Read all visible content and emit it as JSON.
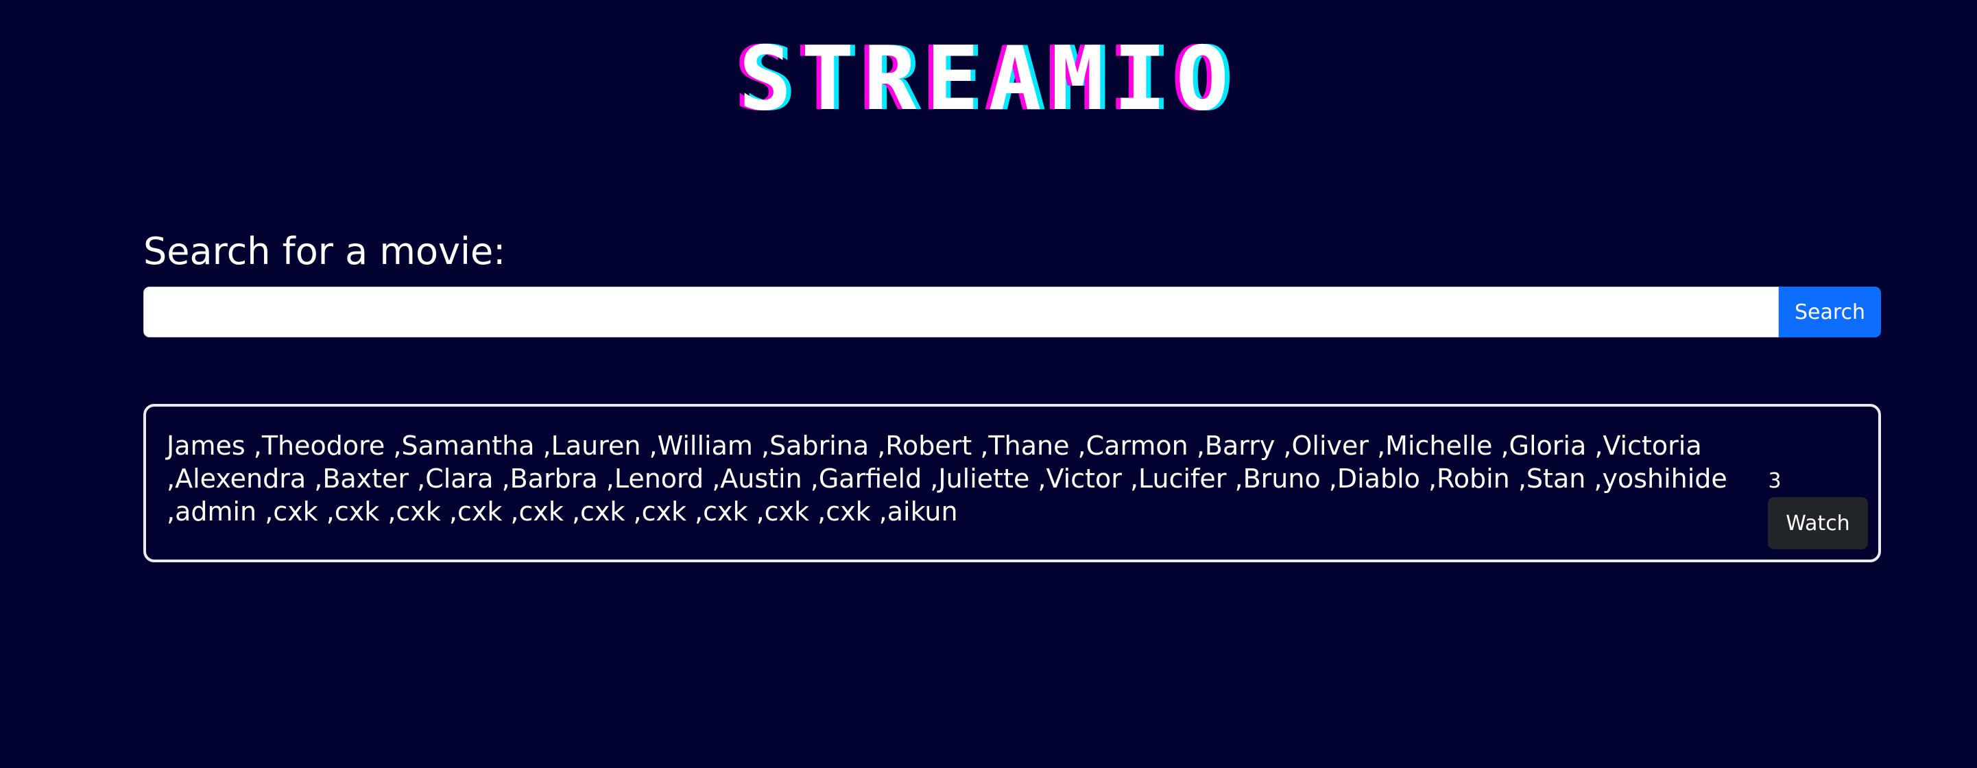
{
  "header": {
    "logo_text": "STREAMIO"
  },
  "search": {
    "label": "Search for a movie:",
    "value": "",
    "button_label": "Search"
  },
  "result": {
    "names": "James ,Theodore ,Samantha ,Lauren ,William ,Sabrina ,Robert ,Thane ,Carmon ,Barry ,Oliver ,Michelle ,Gloria ,Victoria ,Alexendra ,Baxter ,Clara ,Barbra ,Lenord ,Austin ,Garfield ,Juliette ,Victor ,Lucifer ,Bruno ,Diablo ,Robin ,Stan ,yoshihide ,admin ,cxk ,cxk ,cxk ,cxk ,cxk ,cxk ,cxk ,cxk ,cxk ,cxk ,aikun",
    "count": "3",
    "watch_label": "Watch"
  },
  "colors": {
    "background": "#020230",
    "primary_button": "#0d6efd",
    "dark_button": "#212529",
    "logo_magenta": "#ff00e6",
    "logo_cyan": "#00e8ff"
  }
}
